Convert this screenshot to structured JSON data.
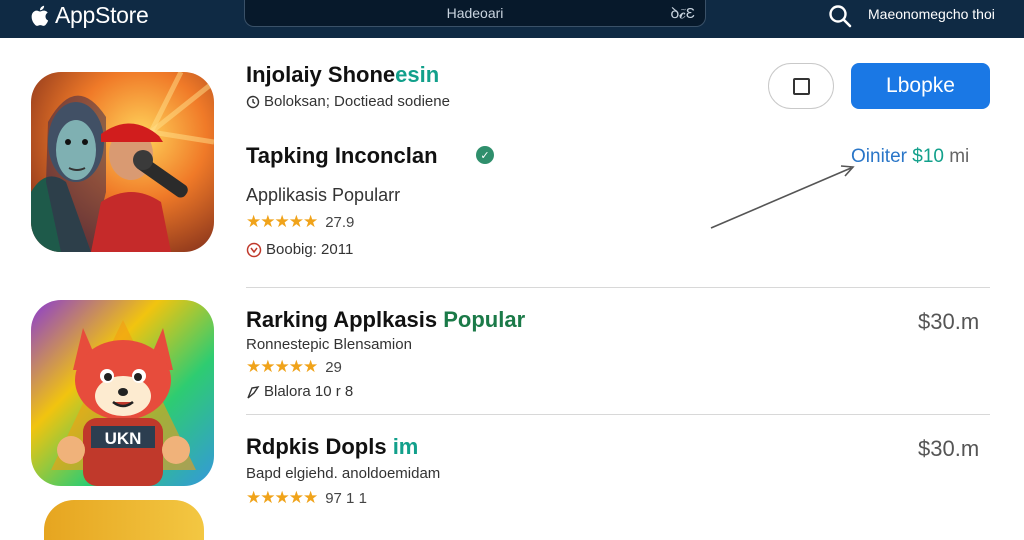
{
  "topbar": {
    "brand": "AppStore",
    "search_text": "Hadeoari",
    "search_icon_text": "ꝺ𝓬̃Ɛ",
    "right_label": "Maeonomegcho thoi"
  },
  "featured": {
    "title_part1": "Injolaiy Shone",
    "title_part2": "esin",
    "meta": "Boloksan; Doctiead sodiene",
    "subtitle": "Tapking Inconclan",
    "category": "Applikasis Popularr",
    "stars": "★★★★★",
    "rating": "27.9",
    "info": "Boobig: 2011",
    "ghost_button": "",
    "primary_button": "Lbopke",
    "offer_1": "Oiniter",
    "offer_2": "$10",
    "offer_3": "mi"
  },
  "rows": [
    {
      "title_part1": "Rarking Applkasis ",
      "title_part2": "Popular",
      "subtitle": "Ronnestepic Blensamion",
      "stars": "★★★★★",
      "rating": "29",
      "info": "Blalora 10 r 8",
      "price": "$30.m"
    },
    {
      "title_part1": "Rdpkis Dopls",
      "title_part2": " im",
      "subtitle": "Bapd elgiehd. anoldoemidam",
      "stars": "★★★★★",
      "rating": "97 1 1",
      "price": "$30.m"
    }
  ],
  "colors": {
    "topbar": "#0f2a44",
    "accent_blue": "#1a78e5",
    "teal": "#12a08b",
    "star": "#f0a31a"
  },
  "icons": [
    "apple-icon",
    "search-icon",
    "check-badge-icon",
    "clock-icon",
    "tag-icon",
    "flag-icon",
    "arrow-annotation"
  ]
}
